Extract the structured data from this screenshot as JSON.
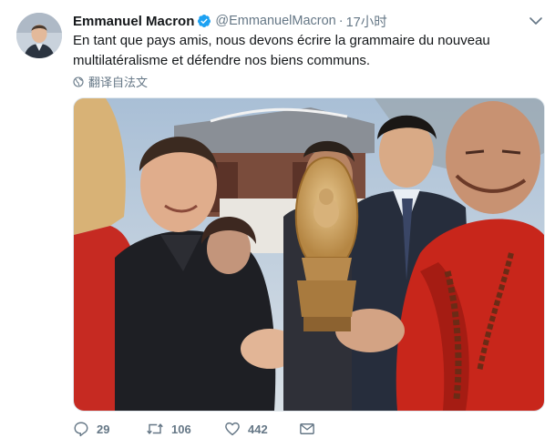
{
  "tweet": {
    "author_name": "Emmanuel Macron",
    "handle": "@EmmanuelMacron",
    "separator": "·",
    "time": "17小时",
    "text": "En tant que pays amis, nous devons écrire la grammaire du nouveau multilatéralisme et défendre nos biens communs.",
    "translate_label": "翻译自法文"
  },
  "actions": {
    "replies": "29",
    "retweets": "106",
    "likes": "442"
  },
  "icons": {
    "verified": "verified-badge-icon",
    "more": "chevron-down-icon",
    "translate": "globe-icon",
    "reply": "reply-icon",
    "retweet": "retweet-icon",
    "like": "heart-icon",
    "message": "envelope-icon"
  },
  "colors": {
    "verified": "#1da1f2",
    "secondary_text": "#657786",
    "primary_text": "#14171a",
    "monk_robe": "#c8261b",
    "statue_gold": "#c49a5a"
  }
}
